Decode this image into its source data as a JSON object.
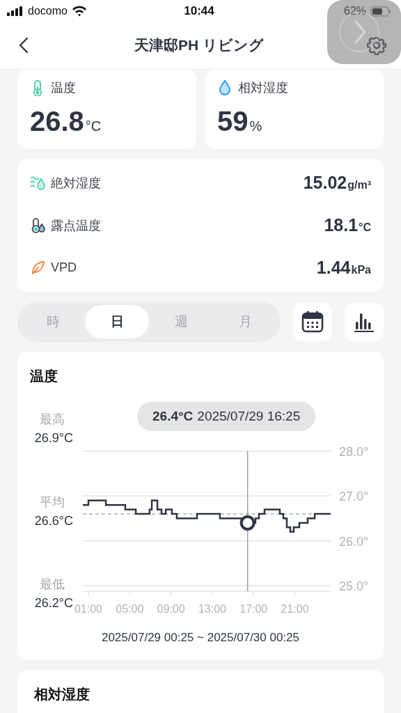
{
  "status_bar": {
    "carrier": "docomo",
    "time": "10:44",
    "battery": "62%"
  },
  "header": {
    "title": "天津邸PH リビング"
  },
  "primary_cards": [
    {
      "kind": "temperature",
      "label": "温度",
      "value": "26.8",
      "unit": "°C"
    },
    {
      "kind": "humidity",
      "label": "相対湿度",
      "value": "59",
      "unit": "%"
    }
  ],
  "metrics": [
    {
      "kind": "absolute_humidity",
      "label": "絶対湿度",
      "value": "15.02",
      "unit": "g/m³"
    },
    {
      "kind": "dew_point",
      "label": "露点温度",
      "value": "18.1",
      "unit": "°C"
    },
    {
      "kind": "vpd",
      "label": "VPD",
      "value": "1.44",
      "unit": "kPa"
    }
  ],
  "period_tabs": [
    {
      "label": "時",
      "selected": false
    },
    {
      "label": "日",
      "selected": true
    },
    {
      "label": "週",
      "selected": false
    },
    {
      "label": "月",
      "selected": false
    }
  ],
  "temperature_chart": {
    "stats": [
      {
        "label": "最高",
        "value": "26.9°C"
      },
      {
        "label": "平均",
        "value": "26.6°C"
      },
      {
        "label": "最低",
        "value": "26.2°C"
      }
    ],
    "range": "2025/07/29 00:25 ~ 2025/07/30 00:25",
    "chart_data": {
      "type": "line",
      "title": "温度",
      "x": [
        0.46,
        1,
        1,
        2.69,
        2.69,
        4.57,
        4.57,
        5.59,
        5.59,
        6.93,
        6.93,
        7.14,
        7.14,
        7.68,
        7.68,
        8.08,
        8.08,
        8.49,
        8.49,
        9.09,
        9.09,
        9.56,
        9.56,
        11.52,
        11.52,
        13.74,
        13.74,
        15.83,
        15.83,
        17.18,
        17.18,
        17.52,
        17.52,
        18.06,
        18.06,
        19.54,
        19.54,
        19.88,
        19.88,
        20.22,
        20.22,
        20.56,
        20.56,
        20.89,
        20.89,
        21.43,
        21.43,
        22.24,
        22.24,
        22.92,
        22.92,
        24.47
      ],
      "series": [
        {
          "color": "#2f3542",
          "values": [
            26.8,
            26.8,
            26.9,
            26.9,
            26.8,
            26.8,
            26.7,
            26.7,
            26.6,
            26.6,
            26.7,
            26.7,
            26.9,
            26.9,
            26.7,
            26.7,
            26.6,
            26.6,
            26.7,
            26.7,
            26.6,
            26.6,
            26.5,
            26.5,
            26.6,
            26.6,
            26.5,
            26.5,
            26.4,
            26.4,
            26.5,
            26.5,
            26.6,
            26.6,
            26.7,
            26.7,
            26.6,
            26.6,
            26.5,
            26.5,
            26.3,
            26.3,
            26.2,
            26.2,
            26.3,
            26.3,
            26.4,
            26.4,
            26.5,
            26.5,
            26.6,
            26.6
          ]
        }
      ],
      "xlim": [
        0.46,
        24.47
      ],
      "ylim": [
        25,
        28
      ],
      "xticks": [
        {
          "value": 1,
          "label": "01:00"
        },
        {
          "value": 5,
          "label": "05:00"
        },
        {
          "value": 9,
          "label": "09:00"
        },
        {
          "value": 13,
          "label": "13:00"
        },
        {
          "value": 17,
          "label": "17:00"
        },
        {
          "value": 21,
          "label": "21:00"
        }
      ],
      "yticks": [
        {
          "value": 25,
          "label": "25.0°"
        },
        {
          "value": 26,
          "label": "26.0°"
        },
        {
          "value": 27,
          "label": "27.0°"
        },
        {
          "value": 28,
          "label": "28.0°"
        }
      ],
      "ref_lines": [
        {
          "axis": "y",
          "value": 26.6
        },
        {
          "axis": "x",
          "value": 16.42
        }
      ]
    },
    "tooltip": {
      "value": "26.4°C",
      "time": "2025/07/29 16:25"
    }
  },
  "next_section": {
    "title": "相対湿度"
  }
}
